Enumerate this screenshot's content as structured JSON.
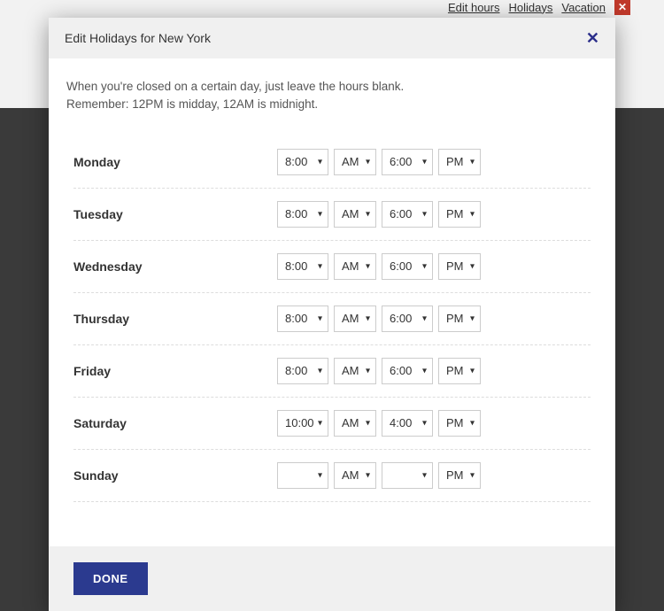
{
  "background": {
    "links": [
      "Edit hours",
      "Holidays",
      "Vacation"
    ],
    "close_glyph": "✕"
  },
  "modal": {
    "title": "Edit Holidays for New York",
    "close_glyph": "✕",
    "intro_line1": "When you're closed on a certain day, just leave the hours blank.",
    "intro_line2": "Remember: 12PM is midday, 12AM is midnight.",
    "done_label": "DONE"
  },
  "days": [
    {
      "name": "Monday",
      "open_time": "8:00",
      "open_ampm": "AM",
      "close_time": "6:00",
      "close_ampm": "PM"
    },
    {
      "name": "Tuesday",
      "open_time": "8:00",
      "open_ampm": "AM",
      "close_time": "6:00",
      "close_ampm": "PM"
    },
    {
      "name": "Wednesday",
      "open_time": "8:00",
      "open_ampm": "AM",
      "close_time": "6:00",
      "close_ampm": "PM"
    },
    {
      "name": "Thursday",
      "open_time": "8:00",
      "open_ampm": "AM",
      "close_time": "6:00",
      "close_ampm": "PM"
    },
    {
      "name": "Friday",
      "open_time": "8:00",
      "open_ampm": "AM",
      "close_time": "6:00",
      "close_ampm": "PM"
    },
    {
      "name": "Saturday",
      "open_time": "10:00",
      "open_ampm": "AM",
      "close_time": "4:00",
      "close_ampm": "PM"
    },
    {
      "name": "Sunday",
      "open_time": "",
      "open_ampm": "AM",
      "close_time": "",
      "close_ampm": "PM"
    }
  ]
}
